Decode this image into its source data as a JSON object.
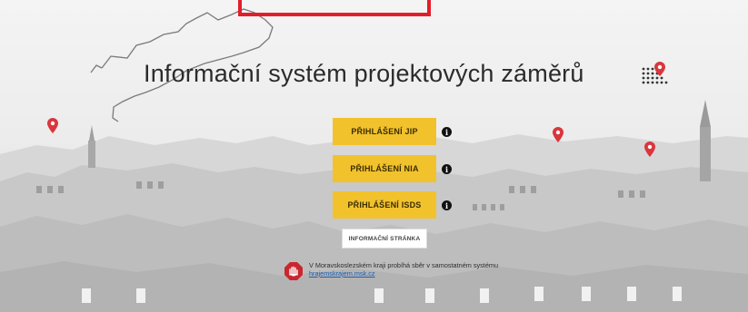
{
  "app": {
    "title": "Informační systém projektových záměrů"
  },
  "login": {
    "jip_label": "PŘIHLÁŠENÍ JIP",
    "nia_label": "PŘIHLÁŠENÍ NIA",
    "isds_label": "PŘIHLÁŠENÍ ISDS",
    "info_glyph": "i"
  },
  "info_page": {
    "label": "INFORMAČNÍ STRÁNKA"
  },
  "notice": {
    "text_before_link": "V Moravskoslezském kraji probíhá sběr v samostatném systému ",
    "link_text": "hrajemskrajem.msk.cz"
  },
  "colors": {
    "accent_yellow": "#f2c22d",
    "highlight_red": "#e31d2b",
    "pin_red": "#d9363e",
    "link_blue": "#1a5fb4"
  },
  "icons": {
    "logo": "map-pin-dots-icon",
    "info": "info-icon",
    "notice": "hand-stop-icon",
    "pins": "map-pin-icon"
  }
}
